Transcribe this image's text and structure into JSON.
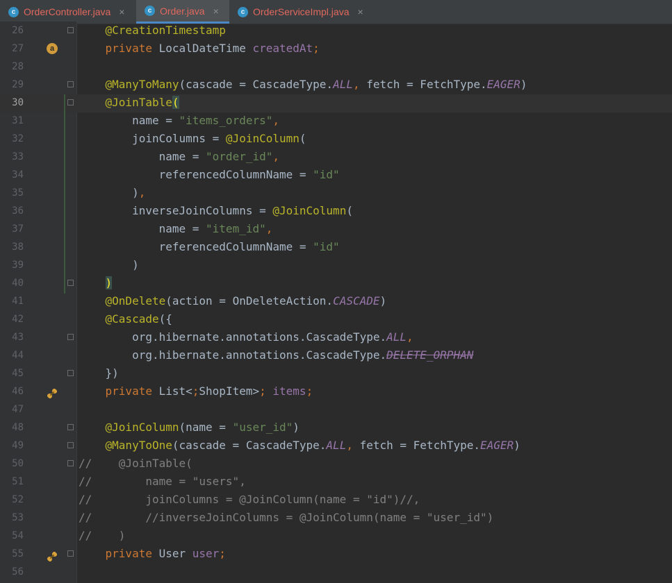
{
  "tabs": [
    {
      "label": "OrderController.java",
      "icon": "java-class-icon",
      "active": false
    },
    {
      "label": "Order.java",
      "icon": "java-class-icon",
      "active": true
    },
    {
      "label": "OrderServiceImpl.java",
      "icon": "java-class-icon",
      "active": false
    }
  ],
  "tab_icon_letter": "c",
  "close_glyph": "×",
  "editor": {
    "current_line": 30,
    "gutter_icons": {
      "line27": "a"
    },
    "lines": [
      {
        "n": "26",
        "text": "    @CreationTimestamp"
      },
      {
        "n": "27",
        "text": "    private LocalDateTime createdAt;"
      },
      {
        "n": "28",
        "text": ""
      },
      {
        "n": "29",
        "text": "    @ManyToMany(cascade = CascadeType.ALL, fetch = FetchType.EAGER)"
      },
      {
        "n": "30",
        "text": "    @JoinTable("
      },
      {
        "n": "31",
        "text": "        name = \"items_orders\","
      },
      {
        "n": "32",
        "text": "        joinColumns = @JoinColumn("
      },
      {
        "n": "33",
        "text": "            name = \"order_id\","
      },
      {
        "n": "34",
        "text": "            referencedColumnName = \"id\""
      },
      {
        "n": "35",
        "text": "        ),"
      },
      {
        "n": "36",
        "text": "        inverseJoinColumns = @JoinColumn("
      },
      {
        "n": "37",
        "text": "            name = \"item_id\","
      },
      {
        "n": "38",
        "text": "            referencedColumnName = \"id\""
      },
      {
        "n": "39",
        "text": "        )"
      },
      {
        "n": "40",
        "text": "    )"
      },
      {
        "n": "41",
        "text": "    @OnDelete(action = OnDeleteAction.CASCADE)"
      },
      {
        "n": "42",
        "text": "    @Cascade({"
      },
      {
        "n": "43",
        "text": "        org.hibernate.annotations.CascadeType.ALL,"
      },
      {
        "n": "44",
        "text": "        org.hibernate.annotations.CascadeType.DELETE_ORPHAN"
      },
      {
        "n": "45",
        "text": "    })"
      },
      {
        "n": "46",
        "text": "    private List<ShopItem> items;"
      },
      {
        "n": "47",
        "text": ""
      },
      {
        "n": "48",
        "text": "    @JoinColumn(name = \"user_id\")"
      },
      {
        "n": "49",
        "text": "    @ManyToOne(cascade = CascadeType.ALL, fetch = FetchType.EAGER)"
      },
      {
        "n": "50",
        "text": "//    @JoinTable("
      },
      {
        "n": "51",
        "text": "//        name = \"users\","
      },
      {
        "n": "52",
        "text": "//        joinColumns = @JoinColumn(name = \"id\")//,"
      },
      {
        "n": "53",
        "text": "//        //inverseJoinColumns = @JoinColumn(name = \"user_id\")"
      },
      {
        "n": "54",
        "text": "//    )"
      },
      {
        "n": "55",
        "text": "    private User user;"
      },
      {
        "n": "56",
        "text": ""
      }
    ]
  },
  "colors": {
    "background": "#2b2b2b",
    "gutter": "#313335",
    "keyword": "#cc7832",
    "annotation": "#bbb529",
    "string": "#6a8759",
    "constant": "#9876aa",
    "comment": "#808080",
    "tab_error_text": "#e0685f"
  }
}
